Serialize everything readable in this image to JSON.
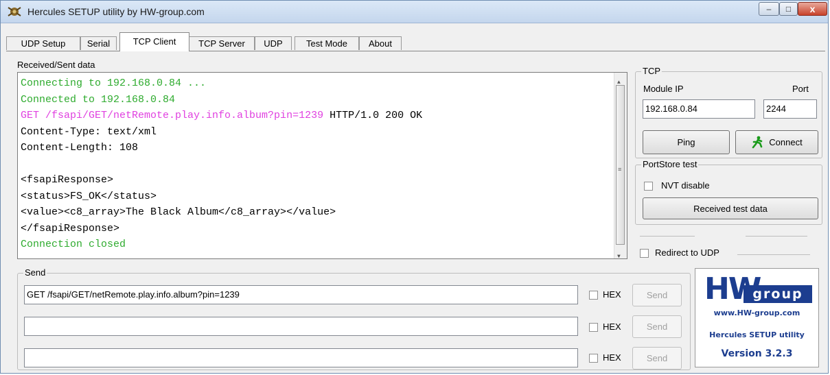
{
  "window": {
    "title": "Hercules SETUP utility by HW-group.com",
    "minimize_glyph": "–",
    "maximize_glyph": "□",
    "close_glyph": "x"
  },
  "tabs": [
    {
      "label": "UDP Setup",
      "active": false
    },
    {
      "label": "Serial",
      "active": false
    },
    {
      "label": "TCP Client",
      "active": true
    },
    {
      "label": "TCP Server",
      "active": false
    },
    {
      "label": "UDP",
      "active": false
    },
    {
      "label": "Test Mode",
      "active": false
    },
    {
      "label": "About",
      "active": false
    }
  ],
  "received": {
    "label": "Received/Sent data",
    "lines": [
      {
        "segments": [
          {
            "text": "Connecting to 192.168.0.84 ...",
            "color": "green"
          }
        ]
      },
      {
        "segments": [
          {
            "text": "Connected to 192.168.0.84",
            "color": "green"
          }
        ]
      },
      {
        "segments": [
          {
            "text": "GET /fsapi/GET/netRemote.play.info.album?pin=1239",
            "color": "magenta"
          },
          {
            "text": " HTTP/1.0 200 OK",
            "color": "black"
          }
        ]
      },
      {
        "segments": [
          {
            "text": "Content-Type: text/xml",
            "color": "black"
          }
        ]
      },
      {
        "segments": [
          {
            "text": "Content-Length: 108",
            "color": "black"
          }
        ]
      },
      {
        "segments": [
          {
            "text": "",
            "color": "black"
          }
        ]
      },
      {
        "segments": [
          {
            "text": "<fsapiResponse>",
            "color": "black"
          }
        ]
      },
      {
        "segments": [
          {
            "text": "<status>FS_OK</status>",
            "color": "black"
          }
        ]
      },
      {
        "segments": [
          {
            "text": "<value><c8_array>The Black Album</c8_array></value>",
            "color": "black"
          }
        ]
      },
      {
        "segments": [
          {
            "text": "</fsapiResponse>",
            "color": "black"
          }
        ]
      },
      {
        "segments": [
          {
            "text": "Connection closed",
            "color": "green"
          }
        ]
      }
    ]
  },
  "tcp": {
    "group_title": "TCP",
    "module_ip_label": "Module IP",
    "module_ip_value": "192.168.0.84",
    "port_label": "Port",
    "port_value": "2244",
    "ping_label": "Ping",
    "connect_label": "Connect"
  },
  "portstore": {
    "group_title": "PortStore test",
    "nvt_label": "NVT disable",
    "received_test_label": "Received test data"
  },
  "redirect_label": "Redirect to UDP",
  "send": {
    "group_title": "Send",
    "hex_label": "HEX",
    "send_label": "Send",
    "rows": [
      {
        "value": "GET /fsapi/GET/netRemote.play.info.album?pin=1239"
      },
      {
        "value": ""
      },
      {
        "value": ""
      }
    ]
  },
  "logo": {
    "hw": "HW",
    "group": "group",
    "url": "www.HW-group.com",
    "subtitle": "Hercules SETUP utility",
    "version": "Version  3.2.3"
  },
  "colors": {
    "green_text": "#2eab2e",
    "magenta_text": "#e040e0",
    "brand_blue": "#1c3d8f"
  }
}
